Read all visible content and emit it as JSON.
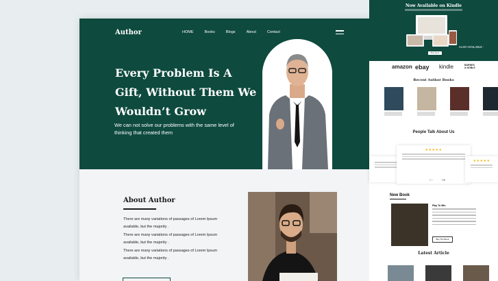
{
  "hero": {
    "logo": "Author",
    "nav": [
      "HOME",
      "Books",
      "Blogs",
      "About",
      "Contact"
    ],
    "headline": "Every Problem Is A Gift, Without Them We Wouldn’t Grow",
    "subtext": "We can not solve our problems with the same level of thinking that created them"
  },
  "about": {
    "heading": "About Author",
    "paragraphs": [
      "There are many variations of passages of Lorem Ipsum available, but the majority .",
      "There are many variations of passages of Lorem Ipsum available, but the majority .",
      "There are many variations of passages of Lorem Ipsum available, but the majority ."
    ]
  },
  "side": {
    "kindle_title": "Now Available on Kindle",
    "also_available": "ALSO AVAILABLE :",
    "buy_now": "Buy Now",
    "brands": [
      "amazon",
      "ebay",
      "kindle",
      "BARNES & NOBLE"
    ],
    "recent_title": "Recent Author Books",
    "testimonials_title": "People Talk About Us",
    "new_book": "New Book",
    "new_book_title": "Play To Win",
    "buy_the_book": "Buy The Book",
    "latest_article": "Latest Article",
    "stars": "★★★★★"
  },
  "colors": {
    "brand_green": "#0e4a3e",
    "star": "#f3b416"
  }
}
